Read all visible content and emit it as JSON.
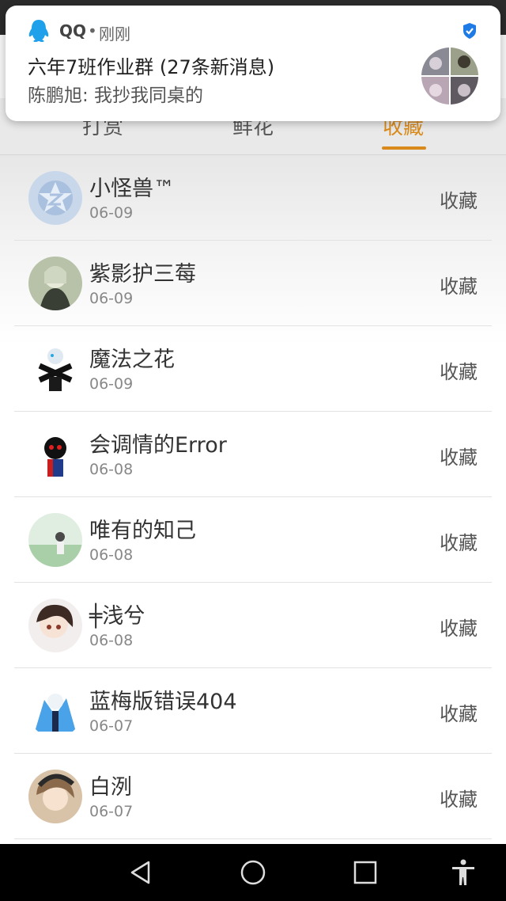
{
  "notification": {
    "app_name": "QQ",
    "separator": "•",
    "time": "刚刚",
    "title": "六年7班作业群 (27条新消息)",
    "preview": "陈鹏旭: 我抄我同桌的",
    "icon": "qq-penguin-icon",
    "badge_icon": "verified-shield-icon"
  },
  "tabs": [
    {
      "label": "打赏",
      "active": false
    },
    {
      "label": "鲜花",
      "active": false
    },
    {
      "label": "收藏",
      "active": true
    }
  ],
  "rows": [
    {
      "name": "小怪兽™",
      "date": "06-09",
      "action": "收藏"
    },
    {
      "name": "紫影护三莓",
      "date": "06-09",
      "action": "收藏"
    },
    {
      "name": "魔法之花",
      "date": "06-09",
      "action": "收藏"
    },
    {
      "name": "会调情的Error",
      "date": "06-08",
      "action": "收藏"
    },
    {
      "name": "唯有的知己",
      "date": "06-08",
      "action": "收藏"
    },
    {
      "name": "╪浅兮",
      "date": "06-08",
      "action": "收藏"
    },
    {
      "name": "蓝梅版错误404",
      "date": "06-07",
      "action": "收藏"
    },
    {
      "name": "白洌",
      "date": "06-07",
      "action": "收藏"
    }
  ],
  "navbar": {
    "back_icon": "back-triangle-icon",
    "home_icon": "home-circle-icon",
    "recents_icon": "recents-square-icon",
    "accessibility_icon": "accessibility-icon"
  },
  "colors": {
    "accent": "#d98a1a",
    "qq_blue": "#1ea0ea"
  }
}
